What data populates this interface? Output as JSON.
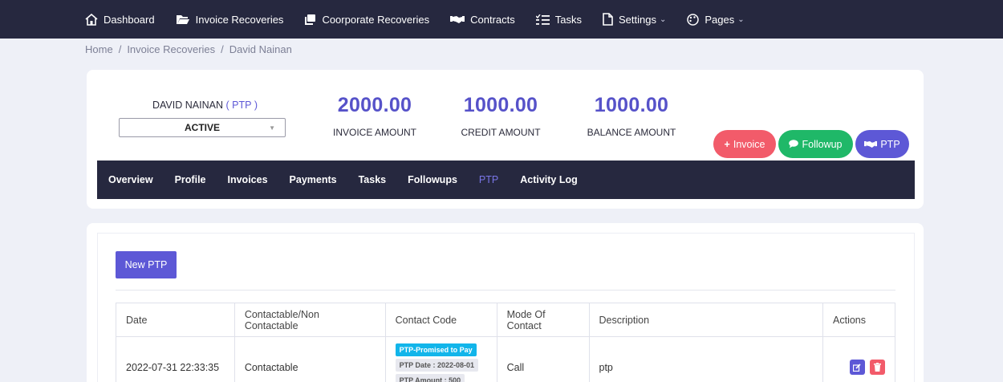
{
  "topnav": {
    "items": [
      {
        "label": "Dashboard",
        "icon": "home-icon"
      },
      {
        "label": "Invoice Recoveries",
        "icon": "folder-icon"
      },
      {
        "label": "Coorporate Recoveries",
        "icon": "copy-icon"
      },
      {
        "label": "Contracts",
        "icon": "handshake-icon"
      },
      {
        "label": "Tasks",
        "icon": "list-icon"
      },
      {
        "label": "Settings",
        "icon": "file-icon"
      },
      {
        "label": "Pages",
        "icon": "palette-icon"
      }
    ]
  },
  "breadcrumb": [
    "Home",
    "Invoice Recoveries",
    "David Nainan"
  ],
  "client": {
    "name": "DAVID NAINAN",
    "status_tag": "PTP",
    "status": "ACTIVE"
  },
  "amounts": {
    "invoice": {
      "value": "2000.00",
      "label": "INVOICE AMOUNT"
    },
    "credit": {
      "value": "1000.00",
      "label": "CREDIT AMOUNT"
    },
    "balance": {
      "value": "1000.00",
      "label": "BALANCE AMOUNT"
    }
  },
  "actions": {
    "invoice": "Invoice",
    "followup": "Followup",
    "ptp": "PTP"
  },
  "subnav": [
    "Overview",
    "Profile",
    "Invoices",
    "Payments",
    "Tasks",
    "Followups",
    "PTP",
    "Activity Log"
  ],
  "subnav_active": "PTP",
  "new_ptp_label": "New PTP",
  "table": {
    "headers": [
      "Date",
      "Contactable/Non Contactable",
      "Contact Code",
      "Mode Of Contact",
      "Description",
      "Actions"
    ],
    "rows": [
      {
        "date": "2022-07-31 22:33:35",
        "contactable": "Contactable",
        "code_tag": "PTP-Promised to Pay",
        "ptp_date": "PTP Date : 2022-08-01",
        "ptp_amount": "PTP Amount : 500",
        "mode": "Call",
        "description": "ptp"
      }
    ]
  },
  "colors": {
    "nav_bg": "#26283f",
    "accent": "#5d58d6",
    "danger": "#f25b6a",
    "success": "#1fb868",
    "info": "#12b5ea"
  }
}
